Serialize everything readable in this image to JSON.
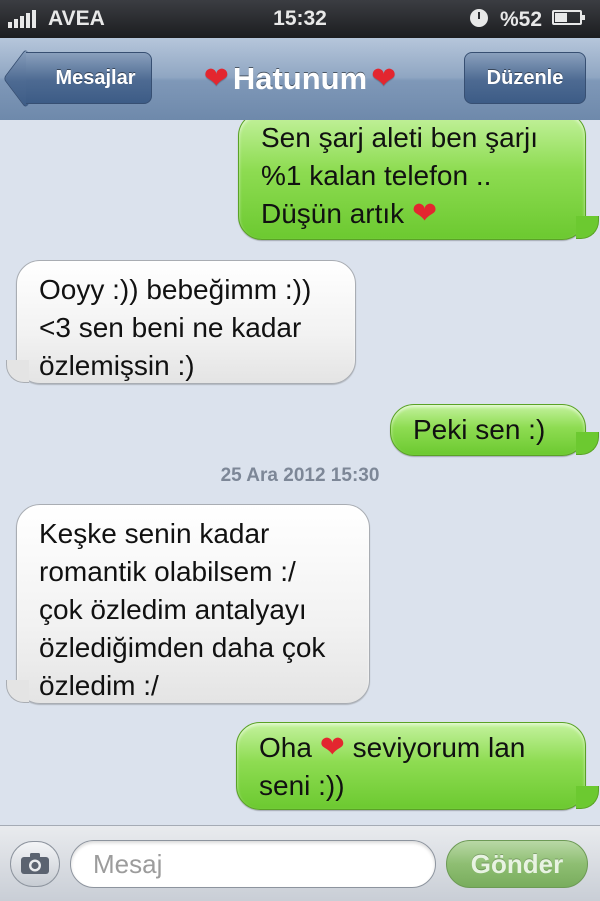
{
  "status_bar": {
    "carrier": "AVEA",
    "time": "15:32",
    "battery_text": "%52",
    "battery_level": 0.52
  },
  "nav": {
    "back_label": "Mesajlar",
    "title": "Hatunum",
    "edit_label": "Düzenle",
    "heart_icon": "red-heart-icon"
  },
  "conversation": {
    "messages": [
      {
        "direction": "sent",
        "lines": [
          "Sen şarj aleti ben şarjı",
          "%1 kalan telefon ..",
          "Düşün artık"
        ]
      },
      {
        "direction": "received",
        "lines": [
          "Ooyy :)) bebeğimm :))",
          "<3 sen beni ne kadar",
          "özlemişsin :)"
        ]
      },
      {
        "direction": "sent",
        "lines": [
          "Peki sen :)"
        ]
      },
      {
        "direction": "received",
        "lines": [
          "Keşke senin kadar",
          "romantik olabilsem :/",
          "çok özledim antalyayı",
          "özlediğimden daha çok",
          "özledim :/"
        ]
      },
      {
        "direction": "sent",
        "lines": [
          "Oha",
          "seviyorum lan",
          "seni :))"
        ]
      }
    ],
    "timestamp": "25 Ara 2012 15:30"
  },
  "input_bar": {
    "placeholder": "Mesaj",
    "send_label": "Gönder"
  },
  "colors": {
    "sent_bubble": "#8edc52",
    "received_bubble": "#f2f2f2",
    "heart": "#e3262f",
    "background": "#dbe2ed"
  }
}
